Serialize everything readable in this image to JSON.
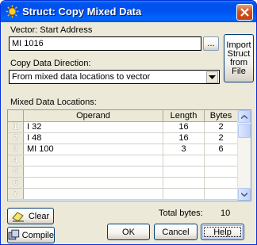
{
  "window": {
    "title": "Struct: Copy Mixed Data"
  },
  "vector": {
    "label": "Vector: Start Address",
    "value": "MI 1016",
    "browse_label": "..."
  },
  "import_button": {
    "lines": [
      "Import",
      "Struct",
      "from",
      "File"
    ]
  },
  "direction": {
    "label": "Copy Data Direction:",
    "selected": "From mixed data locations to vector"
  },
  "locations": {
    "label": "Mixed Data Locations:",
    "columns": [
      "Operand",
      "Length",
      "Bytes"
    ],
    "rows": [
      {
        "num": "1",
        "operand": "I 32",
        "length": "16",
        "bytes": "2"
      },
      {
        "num": "2",
        "operand": "I 48",
        "length": "16",
        "bytes": "2"
      },
      {
        "num": "3",
        "operand": "MI 100",
        "length": "3",
        "bytes": "6"
      },
      {
        "num": "4",
        "operand": "",
        "length": "",
        "bytes": ""
      },
      {
        "num": "5",
        "operand": "",
        "length": "",
        "bytes": ""
      },
      {
        "num": "6",
        "operand": "",
        "length": "",
        "bytes": ""
      },
      {
        "num": "7",
        "operand": "",
        "length": "",
        "bytes": ""
      }
    ]
  },
  "total": {
    "label": "Total bytes:",
    "value": "10"
  },
  "buttons": {
    "clear": "Clear",
    "compile": "Compile",
    "ok": "OK",
    "cancel": "Cancel",
    "help": "Help"
  },
  "colors": {
    "titlebar": "#0053ee",
    "close": "#d0531d",
    "dialog_bg": "#ece9d8"
  }
}
